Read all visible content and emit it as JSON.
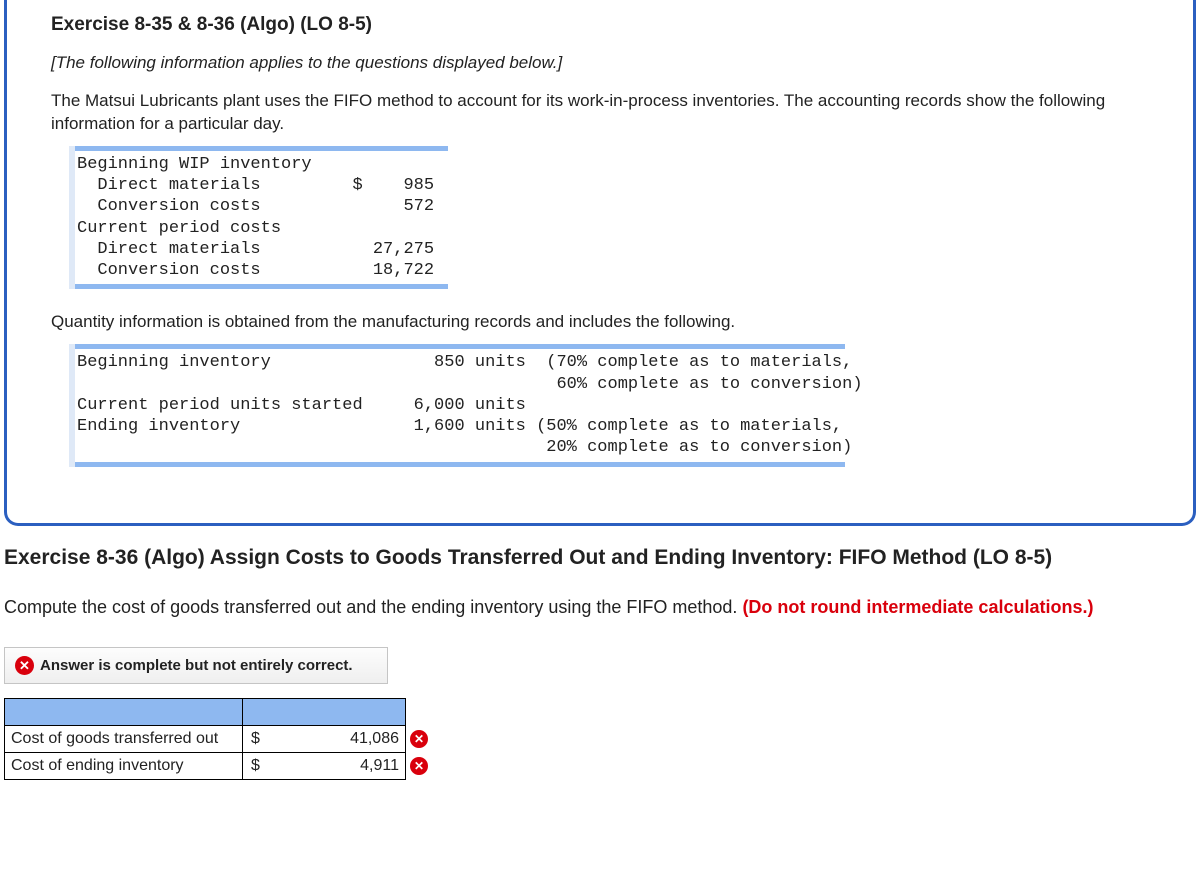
{
  "card": {
    "title": "Exercise 8-35 & 8-36 (Algo) (LO 8-5)",
    "subtitle": "[The following information applies to the questions displayed below.]",
    "intro": "The Matsui Lubricants plant uses the FIFO method to account for its work-in-process inventories. The accounting records show the following information for a particular day.",
    "costblock": "Beginning WIP inventory\n  Direct materials         $    985\n  Conversion costs              572\nCurrent period costs\n  Direct materials           27,275\n  Conversion costs           18,722",
    "qty_intro": "Quantity information is obtained from the manufacturing records and includes the following.",
    "qtyblock": "Beginning inventory                850 units  (70% complete as to materials,\n                                               60% complete as to conversion)\nCurrent period units started     6,000 units\nEnding inventory                 1,600 units (50% complete as to materials,\n                                              20% complete as to conversion)"
  },
  "ex": {
    "title": "Exercise 8-36 (Algo) Assign Costs to Goods Transferred Out and Ending Inventory: FIFO Method (LO 8-5)",
    "instruction_a": "Compute the cost of goods transferred out and the ending inventory using the FIFO method. ",
    "instruction_b": "(Do not round intermediate calculations.)",
    "feedback": "Answer is complete but not entirely correct.",
    "rows": [
      {
        "label": "Cost of goods transferred out",
        "value": "41,086",
        "status": "wrong"
      },
      {
        "label": "Cost of ending inventory",
        "value": "4,911",
        "status": "wrong"
      }
    ]
  }
}
